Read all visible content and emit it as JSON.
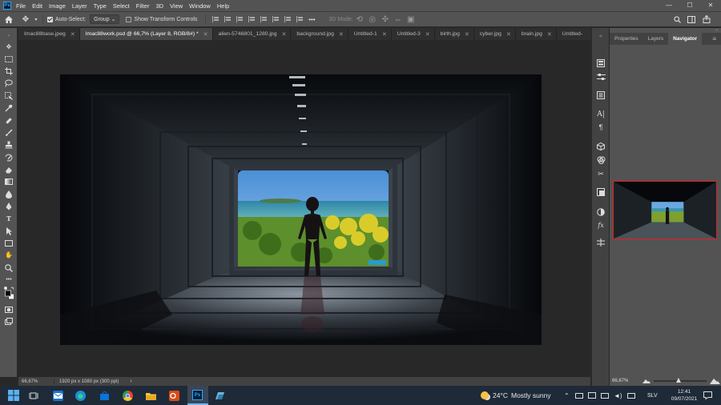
{
  "menubar": {
    "app_badge": "Ps",
    "items": [
      "File",
      "Edit",
      "Image",
      "Layer",
      "Type",
      "Select",
      "Filter",
      "3D",
      "View",
      "Window",
      "Help"
    ]
  },
  "options": {
    "auto_select_label": "Auto-Select:",
    "auto_select_checked": true,
    "auto_select_target": "Group",
    "transform_controls_label": "Show Transform Controls",
    "transform_controls_checked": false,
    "mode_3d_label": "3D Mode:"
  },
  "tabs": [
    {
      "label": "Imac88base.jpeg",
      "active": false,
      "closable": true
    },
    {
      "label": "Imac88work.psd @ 66,7% (Layer 8, RGB/8#) *",
      "active": true,
      "closable": true
    },
    {
      "label": "alien-5746801_1280.jpg",
      "active": false,
      "closable": true
    },
    {
      "label": "background.jpg",
      "active": false,
      "closable": true
    },
    {
      "label": "Untitled-1",
      "active": false,
      "closable": true
    },
    {
      "label": "Untitled-3",
      "active": false,
      "closable": true
    },
    {
      "label": "birth.jpg",
      "active": false,
      "closable": true
    },
    {
      "label": "cyber.jpg",
      "active": false,
      "closable": true
    },
    {
      "label": "brain.jpg",
      "active": false,
      "closable": true
    },
    {
      "label": "Untitled-",
      "active": false,
      "closable": false
    }
  ],
  "tabs_overflow": "»",
  "status": {
    "zoom": "66,67%",
    "doc_info": "1920 px x 1080 px (300 ppi)",
    "arrow": "›"
  },
  "panel": {
    "tabs": [
      "Properties",
      "Layers",
      "Navigator"
    ],
    "active_tab": "Navigator",
    "menu_glyph": "≡",
    "navigator_zoom": "66,67%"
  },
  "taskbar": {
    "weather_temp": "24°C",
    "weather_text": "Mostly sunny",
    "language": "SLV",
    "time": "12:41",
    "date": "09/07/2021"
  },
  "colors": {
    "ui_dark": "#535353",
    "canvas_bg": "#282828",
    "tab_bar": "#2f2f2f",
    "navigator_view_box": "#e02020",
    "taskbar": "#1f2a38",
    "ps_blue": "#31a8ff"
  },
  "icons": {
    "toolbar": [
      "move-tool-icon",
      "marquee-tool-icon",
      "crop-tool-icon",
      "lasso-tool-icon",
      "object-select-tool-icon",
      "eyedropper-tool-icon",
      "healing-brush-icon",
      "brush-tool-icon",
      "clone-stamp-icon",
      "history-brush-icon",
      "eraser-tool-icon",
      "gradient-tool-icon",
      "blur-tool-icon",
      "dodge-tool-icon",
      "pen-tool-icon",
      "type-tool-icon",
      "path-select-icon",
      "rectangle-tool-icon",
      "hand-tool-icon",
      "zoom-tool-icon",
      "more-tools-icon",
      "default-colors-icon",
      "color-swatches-icon",
      "quick-mask-icon",
      "screen-mode-icon"
    ]
  }
}
